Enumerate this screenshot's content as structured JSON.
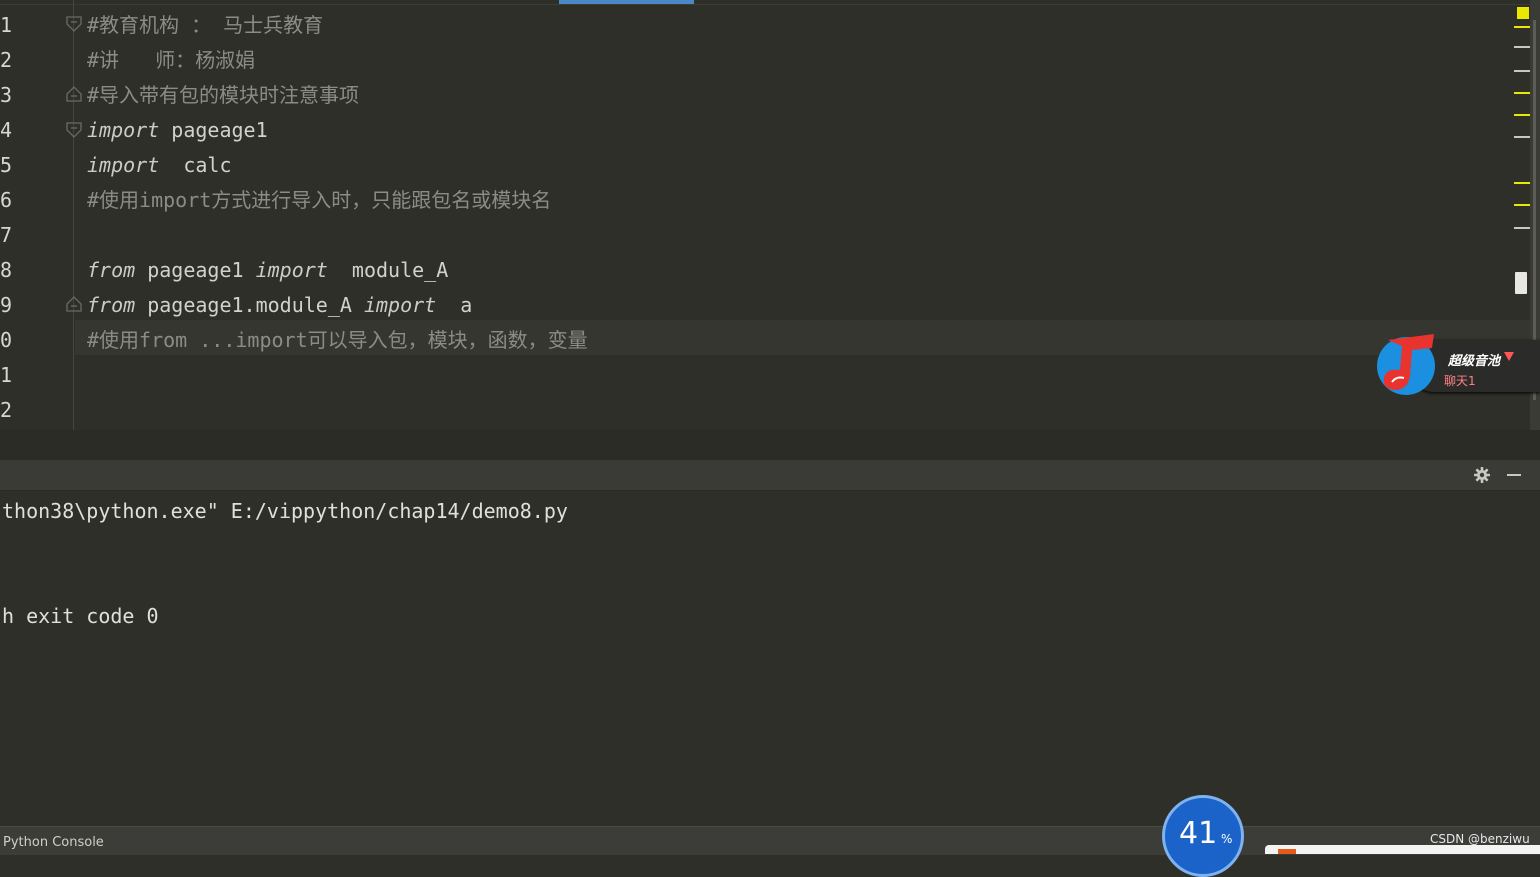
{
  "colors": {
    "background": "#2e2f28",
    "comment": "#8c8c84",
    "keyword": "#ccccc4",
    "identifier": "#d2d2ca",
    "tab_indicator": "#4a88c7",
    "scroll_mark": "#e8e800"
  },
  "editor": {
    "line_numbers": [
      "1",
      "2",
      "3",
      "4",
      "5",
      "6",
      "7",
      "8",
      "9",
      "0",
      "1",
      "2"
    ],
    "lines": [
      [
        {
          "t": "#教育机构 ： 马士兵教育",
          "c": "cmt"
        }
      ],
      [
        {
          "t": "#讲   师：杨淑娟",
          "c": "cmt"
        }
      ],
      [
        {
          "t": "#导入带有包的模块时注意事项",
          "c": "cmt"
        }
      ],
      [
        {
          "t": "import",
          "c": "kw"
        },
        {
          "t": " pageage1",
          "c": "id"
        }
      ],
      [
        {
          "t": "import",
          "c": "kw"
        },
        {
          "t": "  calc",
          "c": "id"
        }
      ],
      [
        {
          "t": "#使用import方式进行导入时，只能跟包名或模块名",
          "c": "cmt"
        }
      ],
      [],
      [
        {
          "t": "from",
          "c": "kw"
        },
        {
          "t": " pageage1 ",
          "c": "id"
        },
        {
          "t": "import",
          "c": "kw"
        },
        {
          "t": "  module_A",
          "c": "id"
        }
      ],
      [
        {
          "t": "from",
          "c": "kw"
        },
        {
          "t": " pageage1.module_A ",
          "c": "id"
        },
        {
          "t": "import",
          "c": "kw"
        },
        {
          "t": "  a",
          "c": "id"
        }
      ],
      [
        {
          "t": "#使用from ...import可以导入包，模块，函数，变量",
          "c": "cmt"
        }
      ],
      [],
      []
    ]
  },
  "widget": {
    "title": "超级音池",
    "subtitle": "聊天1",
    "logo_icon": "music-note-icon"
  },
  "console": {
    "lines": [
      "thon38\\python.exe\" E:/vippython/chap14/demo8.py",
      "",
      "",
      "h exit code 0"
    ]
  },
  "status_bar": {
    "label": "Python Console"
  },
  "badge": {
    "percent": "41",
    "percent_sign": "%"
  },
  "watermark": "CSDN @benziwu"
}
